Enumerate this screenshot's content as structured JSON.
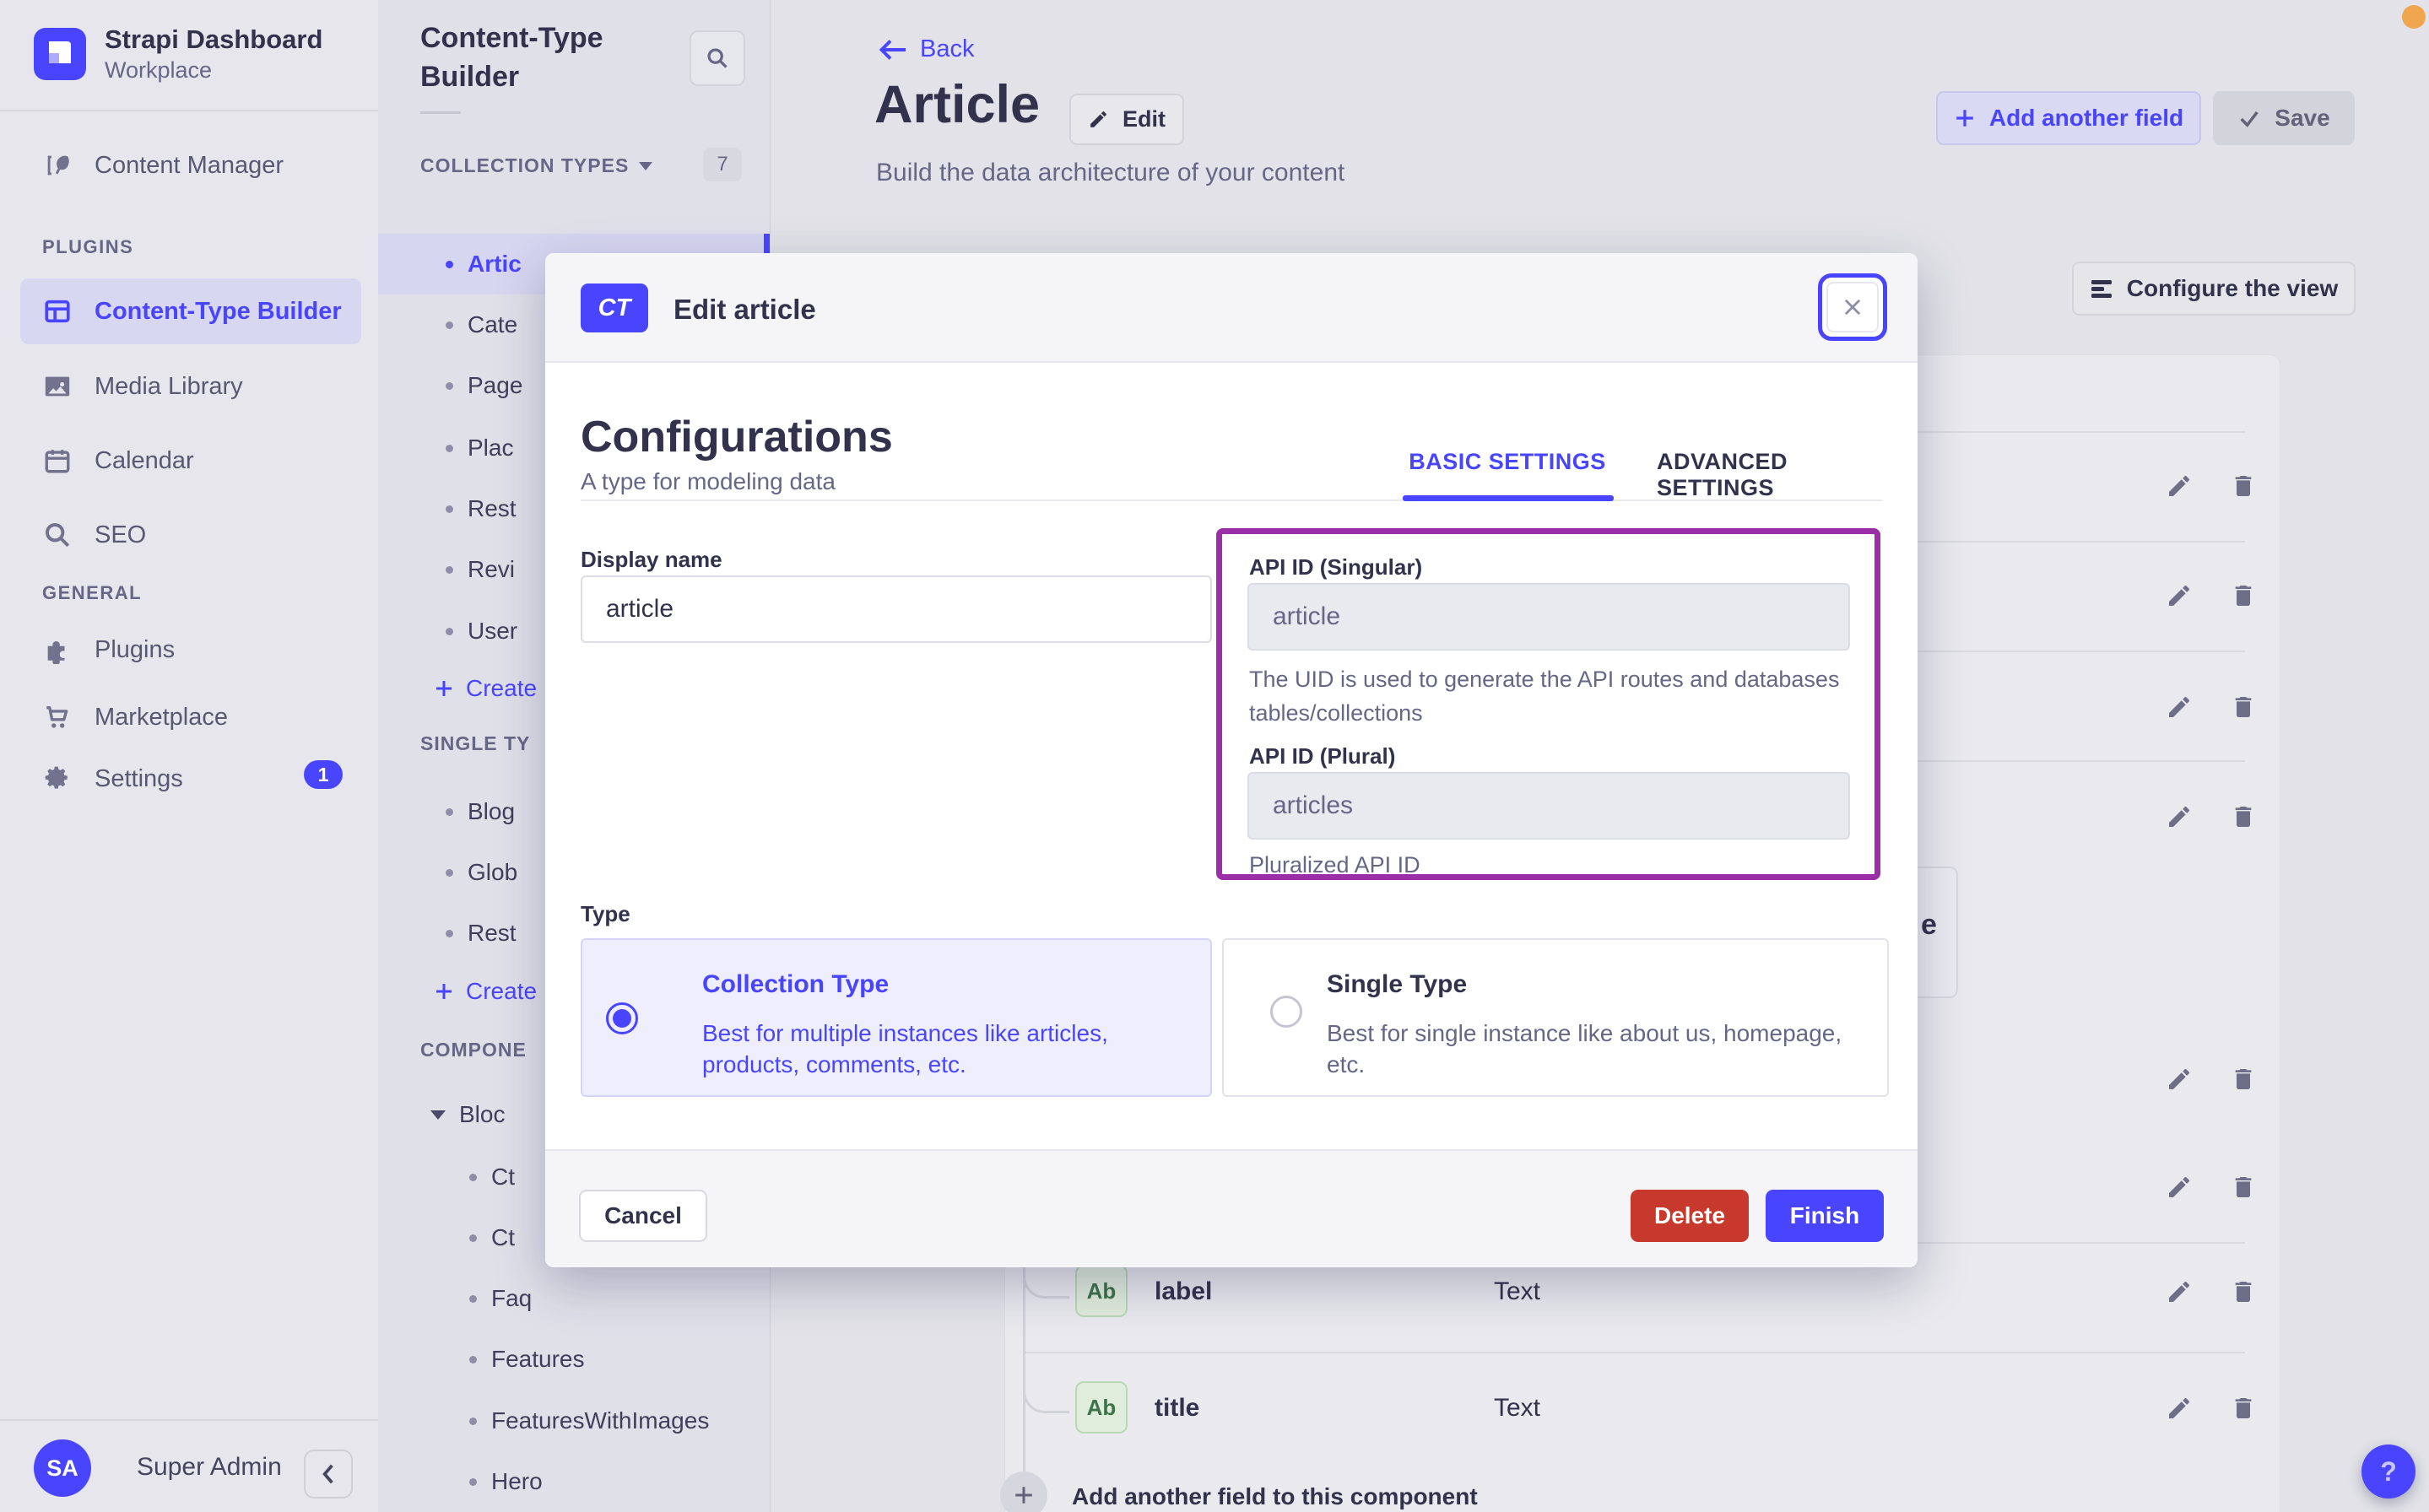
{
  "brand": {
    "name": "Strapi Dashboard",
    "workspace": "Workplace"
  },
  "colors": {
    "accent": "#4945FF",
    "highlight": "#9B2FA7",
    "danger": "#C6392C",
    "success": "#3D7349"
  },
  "sidebar": {
    "content_manager": "Content Manager",
    "plugins_header": "PLUGINS",
    "content_type_builder": "Content-Type Builder",
    "media_library": "Media Library",
    "calendar": "Calendar",
    "seo": "SEO",
    "general_header": "GENERAL",
    "plugins": "Plugins",
    "marketplace": "Marketplace",
    "settings": "Settings",
    "settings_badge": "1",
    "user_initials": "SA",
    "user_name": "Super Admin"
  },
  "subsidebar": {
    "title": "Content-Type Builder",
    "collection_header": "COLLECTION TYPES",
    "collection_count": "7",
    "collection_items": [
      "Artic",
      "Cate",
      "Page",
      "Plac",
      "Rest",
      "Revi",
      "User"
    ],
    "create_collection": "Create",
    "single_header": "SINGLE TY",
    "single_items": [
      "Blog",
      "Glob",
      "Rest"
    ],
    "create_single": "Create",
    "components_header": "COMPONE",
    "component_group": "Bloc",
    "component_items": [
      "Ct",
      "Ct",
      "Faq",
      "Features",
      "FeaturesWithImages",
      "Hero"
    ]
  },
  "header": {
    "back": "Back",
    "title": "Article",
    "edit": "Edit",
    "subtitle": "Build the data architecture of your content",
    "add_field": "Add another field",
    "save": "Save",
    "configure": "Configure the view"
  },
  "panel": {
    "partial_button_text": "e",
    "fields": [
      {
        "badge": "Ab",
        "name": "label",
        "type": "Text"
      },
      {
        "badge": "Ab",
        "name": "title",
        "type": "Text"
      }
    ],
    "add_field_component": "Add another field to this component",
    "help": "?"
  },
  "modal": {
    "badge": "CT",
    "title": "Edit article",
    "section_title": "Configurations",
    "section_subtitle": "A type for modeling data",
    "tabs": {
      "basic": "BASIC SETTINGS",
      "advanced": "ADVANCED SETTINGS"
    },
    "display_name_label": "Display name",
    "display_name_value": "article",
    "api_singular_label": "API ID (Singular)",
    "api_singular_value": "article",
    "api_singular_help": "The UID is used to generate the API routes and databases tables/collections",
    "api_plural_label": "API ID (Plural)",
    "api_plural_value": "articles",
    "api_plural_help": "Pluralized API ID",
    "type_label": "Type",
    "collection_type": {
      "title": "Collection Type",
      "desc": "Best for multiple instances like articles, products, comments, etc."
    },
    "single_type": {
      "title": "Single Type",
      "desc": "Best for single instance like about us, homepage, etc."
    },
    "cancel": "Cancel",
    "delete": "Delete",
    "finish": "Finish"
  }
}
